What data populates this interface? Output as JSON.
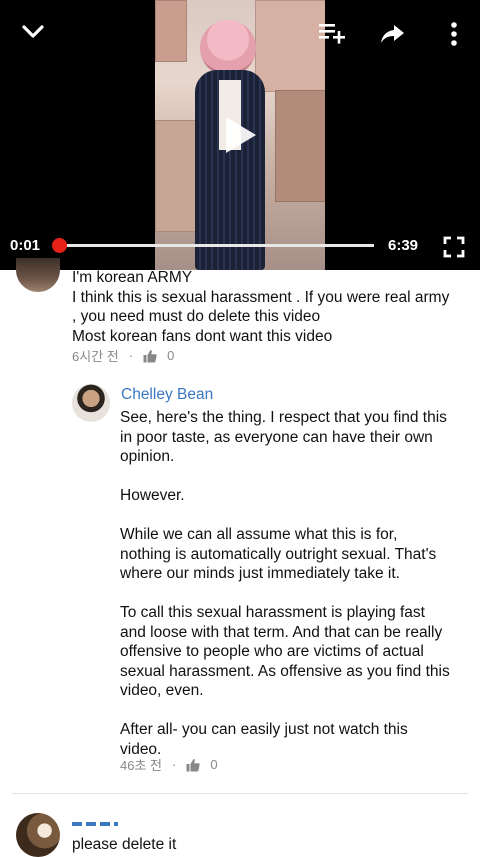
{
  "player": {
    "current_time": "0:01",
    "duration": "6:39",
    "progress": 0.003,
    "icons": [
      "chevron-down-icon",
      "add-to-playlist-icon",
      "share-icon",
      "more-vert-icon",
      "play-icon",
      "fullscreen-icon"
    ]
  },
  "comments": [
    {
      "lines": [
        "I'm korean ARMY",
        "I think this is sexual harassment . If you were real army",
        ", you need must do delete this video",
        "Most korean fans dont want this video"
      ],
      "time": "6시간 전",
      "dot": "·",
      "likes": "0"
    }
  ],
  "reply": {
    "author": "Chelley Bean",
    "lines": [
      "See, here's the thing. I respect that you find this",
      "in poor taste, as everyone can have their own",
      "opinion.",
      "",
      "However.",
      "",
      "While we can all assume what this is for,",
      "nothing is automatically outright sexual. That's",
      "where our minds just immediately take it.",
      "",
      "To call this sexual harassment is playing fast",
      "and loose with that term. And that can be really",
      "offensive to people who are victims of actual",
      "sexual harassment. As offensive as you find this",
      "video, even.",
      "",
      "After all- you can easily just not watch this",
      "video."
    ],
    "time": "46초 전",
    "dot": "·",
    "likes": "0"
  },
  "last_comment": {
    "text": "please delete it"
  },
  "colors": {
    "accent_red": "#e62117",
    "link_blue": "#3b78c2"
  }
}
